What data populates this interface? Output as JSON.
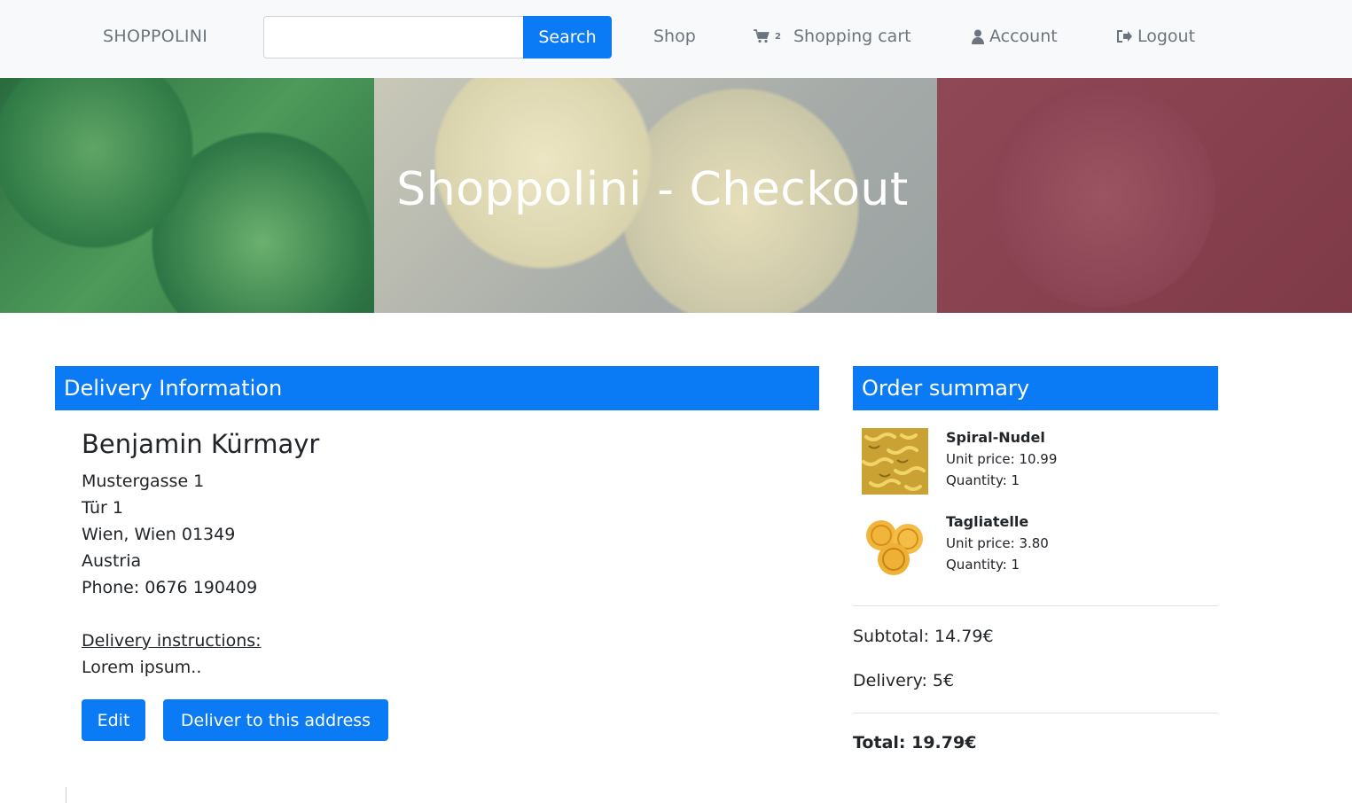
{
  "navbar": {
    "brand": "SHOPPOLINI",
    "search_value": "",
    "search_button": "Search",
    "shop": "Shop",
    "cart_count": "2",
    "cart": "Shopping cart",
    "account": "Account",
    "logout": "Logout",
    "icons": [
      "shopping-cart-icon",
      "user-icon",
      "logout-icon"
    ]
  },
  "hero": {
    "title": "Shoppolini - Checkout"
  },
  "delivery": {
    "header": "Delivery Information",
    "name": "Benjamin Kürmayr",
    "address_lines": [
      "Mustergasse 1",
      "Tür 1",
      "Wien, Wien 01349",
      "Austria",
      "Phone: 0676 190409"
    ],
    "instructions_label": "Delivery instructions:",
    "instructions": "Lorem ipsum..",
    "edit_button": "Edit",
    "deliver_button": "Deliver to this address"
  },
  "summary": {
    "header": "Order summary",
    "items": [
      {
        "name": "Spiral-Nudel",
        "unit_price": "Unit price: 10.99",
        "quantity": "Quantity: 1"
      },
      {
        "name": "Tagliatelle",
        "unit_price": "Unit price: 3.80",
        "quantity": "Quantity: 1"
      }
    ],
    "subtotal": "Subtotal: 14.79€",
    "delivery": "Delivery: 5€",
    "total": "Total: 19.79€"
  },
  "colors": {
    "primary": "#0b7bf5",
    "navbar_bg": "#f8f9fa",
    "muted_text": "#6c757d"
  }
}
